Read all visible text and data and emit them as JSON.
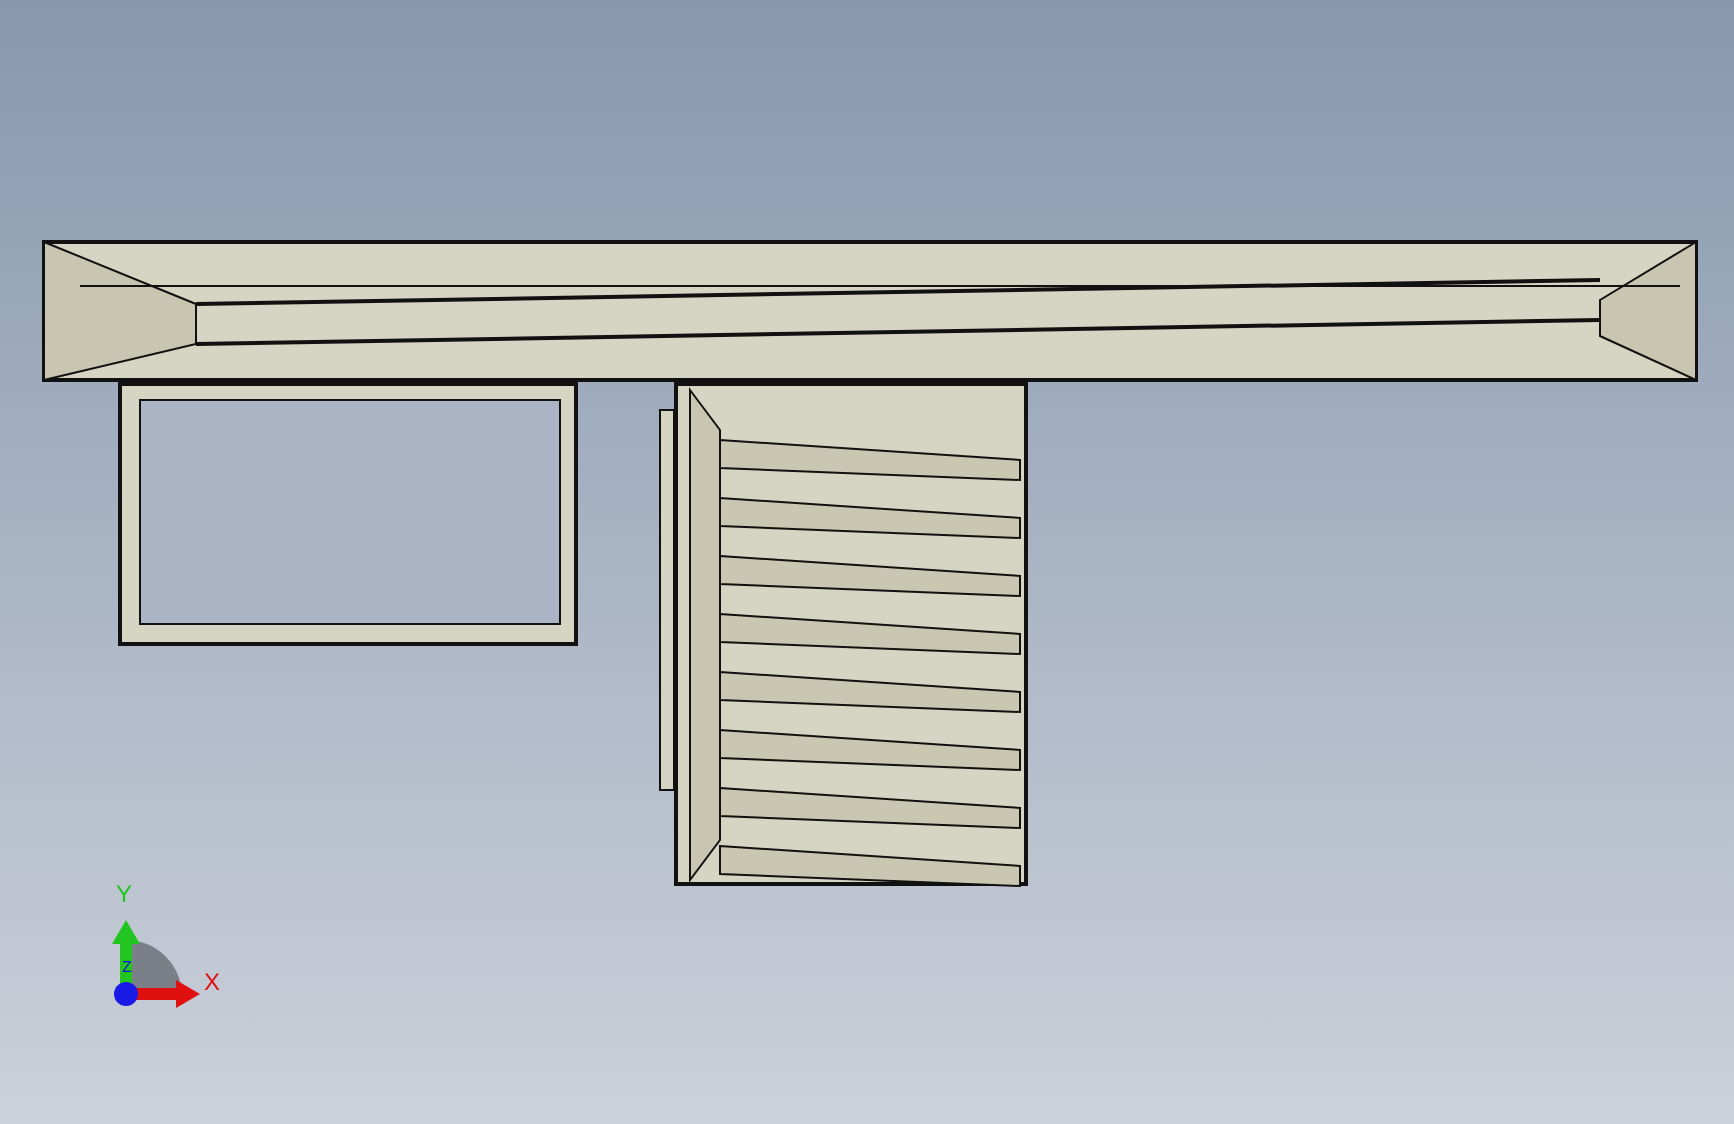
{
  "viewport": {
    "axis_labels": [
      {
        "kind": "y",
        "label": "Y"
      },
      {
        "kind": "x",
        "label": "X"
      },
      {
        "kind": "z",
        "label": "Z"
      }
    ]
  }
}
